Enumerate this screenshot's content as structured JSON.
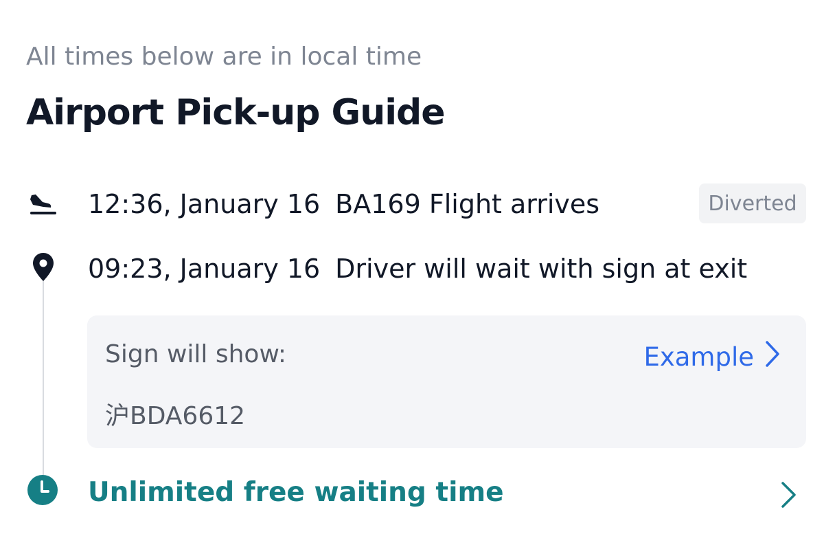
{
  "header": {
    "subtitle": "All times below are in local time",
    "title": "Airport Pick-up Guide"
  },
  "timeline": {
    "flight": {
      "icon": "flight-arrival-icon",
      "time": "12:36, January 16",
      "text": "BA169 Flight arrives",
      "status": "Diverted"
    },
    "driver": {
      "icon": "location-pin-icon",
      "time": "09:23, January 16",
      "text": "Driver will wait with sign at exit"
    },
    "sign_card": {
      "label": "Sign will show:",
      "value": "沪BDA6612",
      "example_label": "Example"
    },
    "waiting": {
      "icon": "clock-icon",
      "text": "Unlimited free waiting time"
    }
  },
  "colors": {
    "text_primary": "#111827",
    "text_muted": "#7e8592",
    "link_blue": "#2f6ae8",
    "teal": "#167f85",
    "card_bg": "#f4f5f8",
    "badge_bg": "#f2f3f5",
    "timeline_line": "#d8dbe0"
  }
}
